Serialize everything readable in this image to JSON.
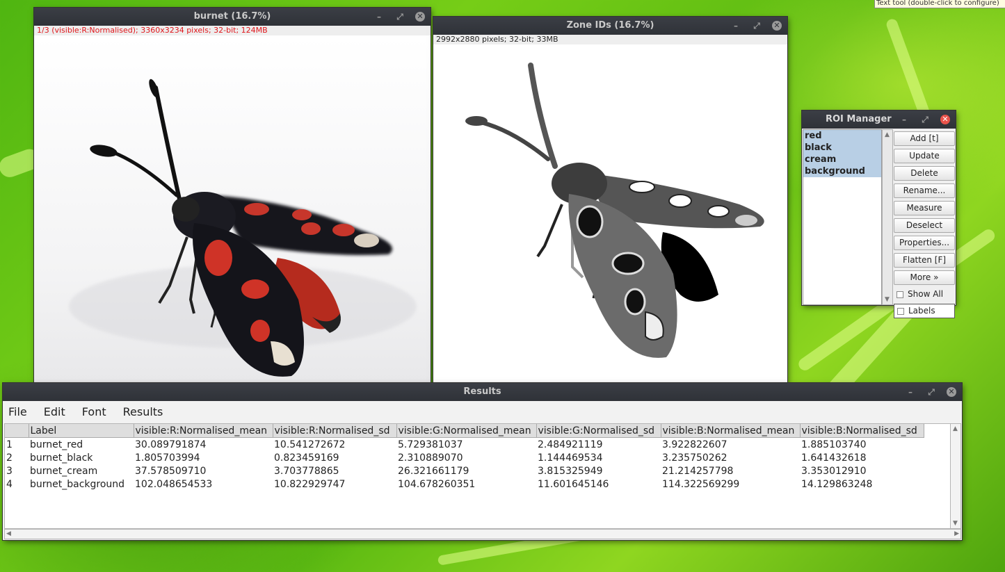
{
  "tooltip": "Text tool (double-click to configure)",
  "burnet_window": {
    "title": "burnet (16.7%)",
    "info": "1/3 (visible:R:Normalised); 3360x3234 pixels; 32-bit; 124MB",
    "info_color": "#e0161b"
  },
  "zone_window": {
    "title": "Zone IDs (16.7%)",
    "info": "2992x2880 pixels; 32-bit; 33MB"
  },
  "roi_manager": {
    "title": "ROI Manager",
    "items": [
      "red",
      "black",
      "cream",
      "background"
    ],
    "buttons": [
      "Add [t]",
      "Update",
      "Delete",
      "Rename...",
      "Measure",
      "Deselect",
      "Properties...",
      "Flatten [F]",
      "More »"
    ],
    "checkboxes": [
      "Show All",
      "Labels"
    ]
  },
  "results": {
    "title": "Results",
    "menus": [
      "File",
      "Edit",
      "Font",
      "Results"
    ],
    "columns": [
      "",
      "Label",
      "visible:R:Normalised_mean",
      "visible:R:Normalised_sd",
      "visible:G:Normalised_mean",
      "visible:G:Normalised_sd",
      "visible:B:Normalised_mean",
      "visible:B:Normalised_sd"
    ],
    "rows": [
      [
        "1",
        "burnet_red",
        "30.089791874",
        "10.541272672",
        "5.729381037",
        "2.484921119",
        "3.922822607",
        "1.885103740"
      ],
      [
        "2",
        "burnet_black",
        "1.805703994",
        "0.823459169",
        "2.310889070",
        "1.144469534",
        "3.235750262",
        "1.641432618"
      ],
      [
        "3",
        "burnet_cream",
        "37.578509710",
        "3.703778865",
        "26.321661179",
        "3.815325949",
        "21.214257798",
        "3.353012910"
      ],
      [
        "4",
        "burnet_background",
        "102.048654533",
        "10.822929747",
        "104.678260351",
        "11.601645146",
        "114.322569299",
        "14.129863248"
      ]
    ]
  },
  "icons": [
    "minimize-icon",
    "maximize-icon",
    "close-icon"
  ]
}
